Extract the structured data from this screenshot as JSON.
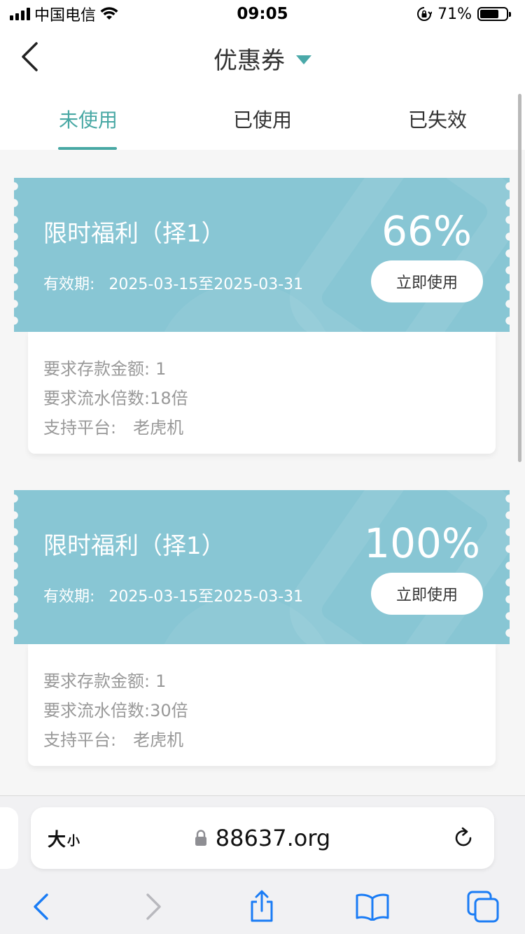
{
  "status_bar": {
    "carrier": "中国电信",
    "time": "09:05",
    "battery_percent": "71%",
    "battery_level": 0.71
  },
  "nav": {
    "title": "优惠券"
  },
  "tabs": [
    {
      "label": "未使用",
      "active": true
    },
    {
      "label": "已使用",
      "active": false
    },
    {
      "label": "已失效",
      "active": false
    }
  ],
  "coupons": [
    {
      "title": "限时福利（择1）",
      "validity_label": "有效期:",
      "validity": "2025-03-15至2025-03-31",
      "percent": "66%",
      "button": "立即使用",
      "deposit_label": "要求存款金额:",
      "deposit_value": "1",
      "turnover_label": "要求流水倍数:",
      "turnover_value": "18倍",
      "platform_label": "支持平台:",
      "platform_value": "老虎机"
    },
    {
      "title": "限时福利（择1）",
      "validity_label": "有效期:",
      "validity": "2025-03-15至2025-03-31",
      "percent": "100%",
      "button": "立即使用",
      "deposit_label": "要求存款金额:",
      "deposit_value": "1",
      "turnover_label": "要求流水倍数:",
      "turnover_value": "30倍",
      "platform_label": "支持平台:",
      "platform_value": "老虎机"
    }
  ],
  "browser": {
    "aa_big": "大",
    "aa_small": "小",
    "url": "88637.org"
  },
  "colors": {
    "accent": "#48a8a4",
    "coupon_bg": "#88c6d4",
    "safari_blue": "#1a7cf5"
  }
}
